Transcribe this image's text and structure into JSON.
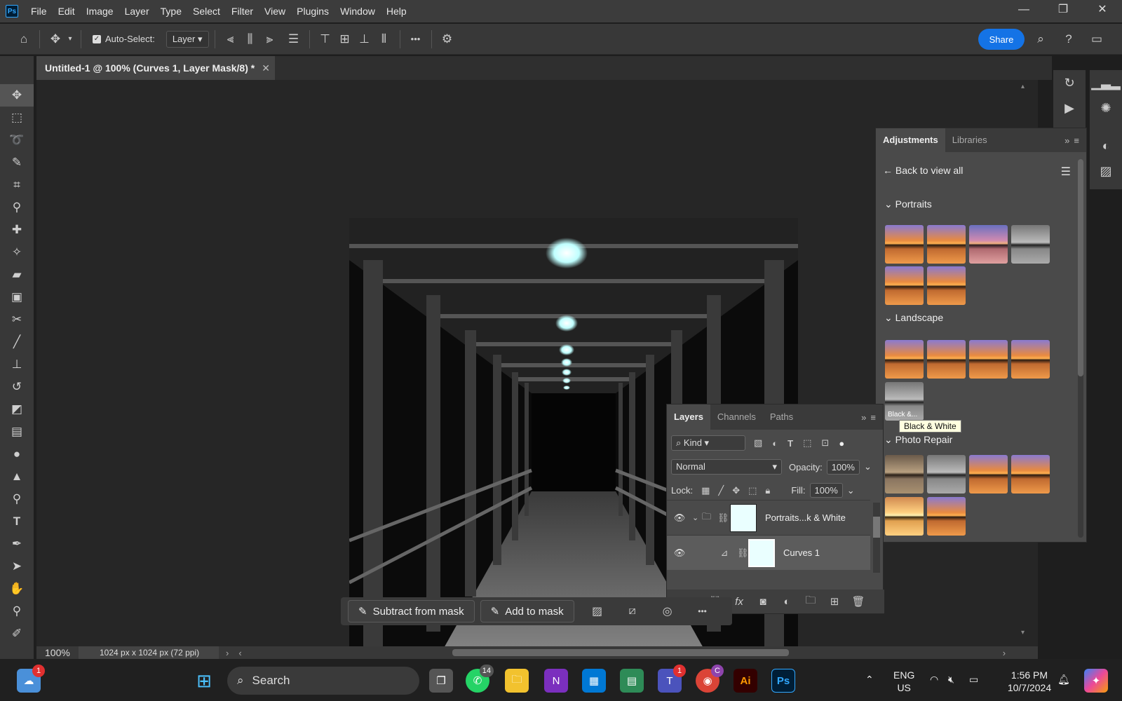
{
  "app": {
    "logo": "Ps"
  },
  "menu": [
    "File",
    "Edit",
    "Image",
    "Layer",
    "Type",
    "Select",
    "Filter",
    "View",
    "Plugins",
    "Window",
    "Help"
  ],
  "window_controls": {
    "minimize": "—",
    "restore": "❐",
    "close": "✕"
  },
  "options": {
    "auto_select_label": "Auto-Select:",
    "auto_select_value": "Layer",
    "more": "•••",
    "share_label": "Share"
  },
  "document": {
    "tab_title": "Untitled-1 @ 100% (Curves 1, Layer Mask/8) *",
    "close": "✕",
    "zoom": "100%",
    "size_info": "1024 px x 1024 px (72 ppi)"
  },
  "adjustments": {
    "tabs": [
      "Adjustments",
      "Libraries"
    ],
    "back_label": "Back to view all",
    "sections": [
      {
        "title": "Portraits"
      },
      {
        "title": "Landscape"
      },
      {
        "title": "Photo Repair"
      }
    ],
    "bw_thumb_label": "Black &...",
    "tooltip": "Black & White"
  },
  "layers": {
    "tabs": [
      "Layers",
      "Channels",
      "Paths"
    ],
    "kind_label": "Kind",
    "blend_mode": "Normal",
    "opacity_label": "Opacity:",
    "opacity_value": "100%",
    "lock_label": "Lock:",
    "fill_label": "Fill:",
    "fill_value": "100%",
    "items": [
      {
        "name": "Portraits...k & White"
      },
      {
        "name": "Curves 1"
      }
    ],
    "fx_label": "fx"
  },
  "mask_bar": {
    "subtract_label": "Subtract from mask",
    "add_label": "Add to mask",
    "more": "•••"
  },
  "taskbar": {
    "search_label": "Search",
    "weather_badge": "1",
    "whatsapp_badge": "14",
    "teams_badge": "1",
    "chrome_badge": "C",
    "illustrator_label": "Ai",
    "photoshop_label": "Ps",
    "onenote_label": "N",
    "lang_line1": "ENG",
    "lang_line2": "US",
    "time": "1:56 PM",
    "date": "10/7/2024"
  },
  "colors": {
    "accent": "#1473e6",
    "panel": "#4a4a4a",
    "menubar": "#3c3c3c"
  }
}
